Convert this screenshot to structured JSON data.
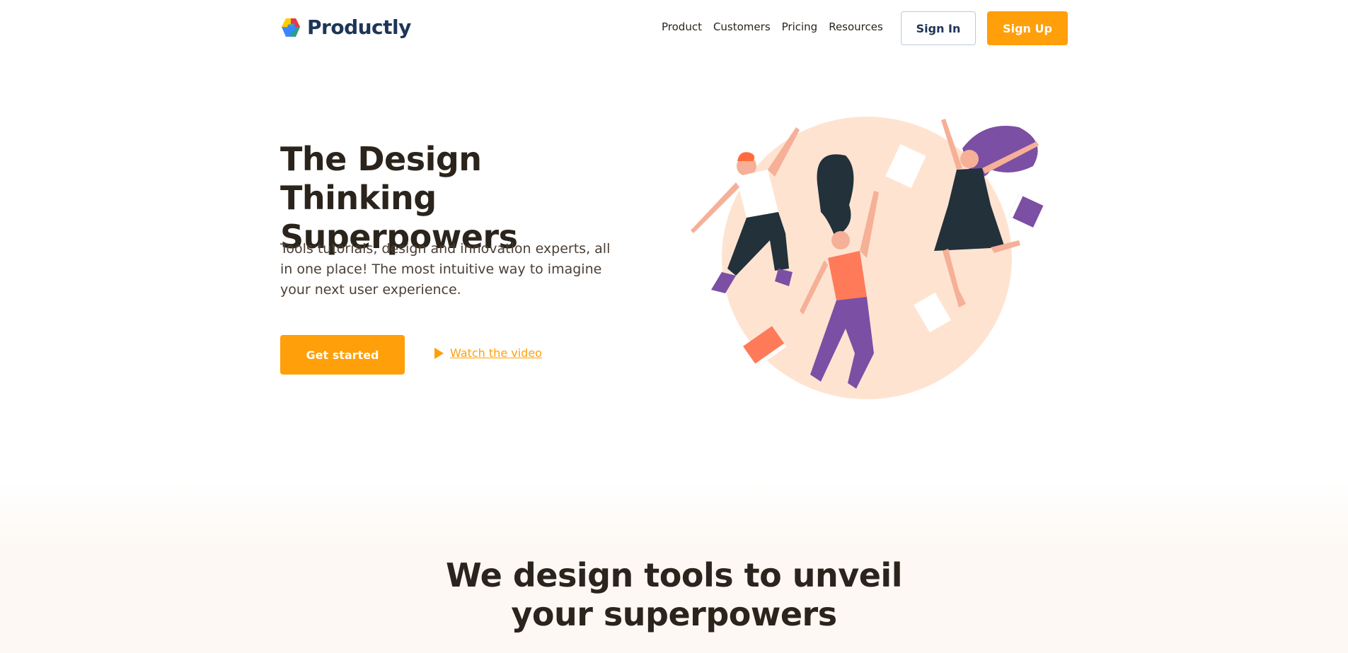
{
  "brand": {
    "name": "Productly"
  },
  "nav": {
    "items": [
      "Product",
      "Customers",
      "Pricing",
      "Resources"
    ]
  },
  "auth": {
    "signin_label": "Sign In",
    "signup_label": "Sign Up"
  },
  "hero": {
    "title_line1": "The Design Thinking",
    "title_line2": "Superpowers",
    "description": "Tools tutorials, design and innovation experts, all in one place! The most intuitive way to imagine your next user experience.",
    "cta_label": "Get started",
    "video_label": "Watch the video"
  },
  "section2": {
    "title_line1": "We design tools to unveil",
    "title_line2": "your superpowers"
  },
  "colors": {
    "accent": "#ff9f0a",
    "brand_text": "#1d3557",
    "heading": "#2b241c",
    "blob": "#ffe3d1"
  },
  "icons": [
    "productly-logo-icon",
    "play-icon"
  ]
}
